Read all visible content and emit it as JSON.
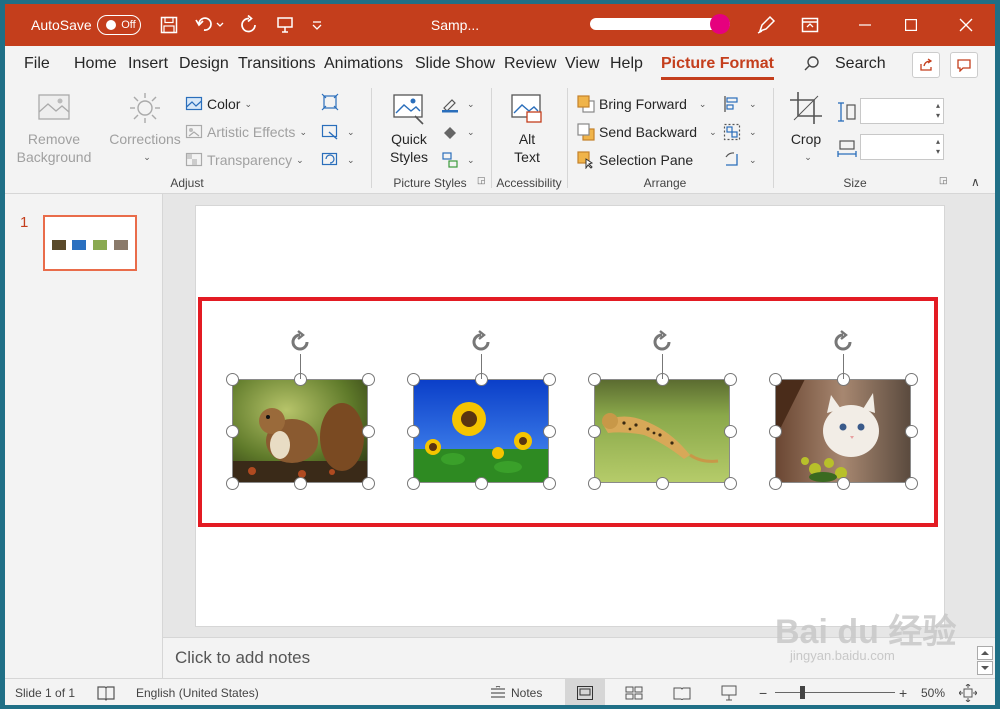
{
  "titlebar": {
    "autosave_label": "AutoSave",
    "autosave_state": "Off",
    "doc_title": "Samp...",
    "icons": [
      "save-icon",
      "undo-icon",
      "redo-icon",
      "present-icon",
      "customize-icon",
      "pen-icon",
      "ribbon-display-icon",
      "minimize-icon",
      "maximize-icon",
      "close-icon"
    ]
  },
  "menu": {
    "tabs": [
      "File",
      "Home",
      "Insert",
      "Design",
      "Transitions",
      "Animations",
      "Slide Show",
      "Review",
      "View",
      "Help",
      "Picture Format"
    ],
    "active_tab": "Picture Format",
    "search_label": "Search"
  },
  "ribbon": {
    "adjust": {
      "remove_bg": [
        "Remove",
        "Background"
      ],
      "corrections": "Corrections",
      "color": "Color",
      "artistic": "Artistic Effects",
      "transparency": "Transparency",
      "label": "Adjust"
    },
    "styles": {
      "quick": [
        "Quick",
        "Styles"
      ],
      "label": "Picture Styles"
    },
    "accessibility": {
      "alt": [
        "Alt",
        "Text"
      ],
      "label": "Accessibility"
    },
    "arrange": {
      "bring_forward": "Bring Forward",
      "send_backward": "Send Backward",
      "selection_pane": "Selection Pane",
      "label": "Arrange"
    },
    "size": {
      "crop": "Crop",
      "label": "Size"
    }
  },
  "slides": {
    "current_number": "1",
    "pictures": [
      "squirrel",
      "sunflower",
      "cheetah",
      "kitten"
    ]
  },
  "notes": {
    "placeholder": "Click to add notes"
  },
  "status": {
    "slide_info": "Slide 1 of 1",
    "language": "English (United States)",
    "notes_label": "Notes",
    "zoom_minus": "−",
    "zoom_plus": "+",
    "zoom": "50%"
  },
  "watermark": {
    "brand": "Bai du 经验",
    "url": "jingyan.baidu.com"
  },
  "colors": {
    "accent": "#c43e1c",
    "selection_box": "#e31b23",
    "thumb_border": "#e96c4a"
  }
}
